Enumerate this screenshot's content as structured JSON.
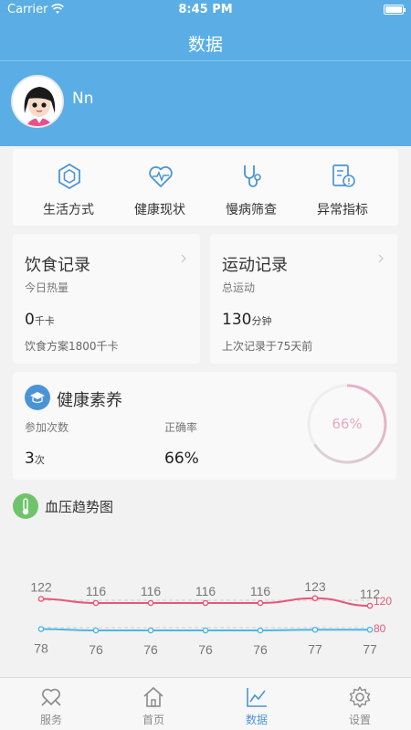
{
  "status_bar": {
    "carrier": "Carrier",
    "time": "8:45 PM"
  },
  "nav": {
    "title": "数据"
  },
  "user": {
    "name": "Nn"
  },
  "menu": [
    {
      "label": "生活方式",
      "icon": "hexagon-icon"
    },
    {
      "label": "健康现状",
      "icon": "heart-pulse-icon"
    },
    {
      "label": "慢病筛查",
      "icon": "stethoscope-icon"
    },
    {
      "label": "异常指标",
      "icon": "alert-report-icon"
    }
  ],
  "diet": {
    "title": "饮食记录",
    "subtitle": "今日热量",
    "value": "0",
    "unit": "千卡",
    "footer": "饮食方案1800千卡"
  },
  "exercise": {
    "title": "运动记录",
    "subtitle": "总运动",
    "value": "130",
    "unit": "分钟",
    "footer": "上次记录于75天前"
  },
  "health_literacy": {
    "title": "健康素养",
    "participation_label": "参加次数",
    "participation_value": "3",
    "participation_unit": "次",
    "accuracy_label": "正确率",
    "accuracy_value": "66%",
    "ring_text": "66%",
    "ring_fraction": 0.66
  },
  "bp": {
    "title": "血压趋势图"
  },
  "chart_data": {
    "type": "line",
    "title": "血压趋势图",
    "x": [
      1,
      2,
      3,
      4,
      5,
      6,
      7
    ],
    "series": [
      {
        "values": [
          122,
          116,
          116,
          116,
          116,
          123,
          112
        ],
        "color": "#e8557a"
      },
      {
        "values": [
          78,
          76,
          76,
          76,
          76,
          77,
          77
        ],
        "color": "#4fb5e3"
      }
    ],
    "reference_lines": [
      {
        "value": 120,
        "label": "120",
        "color": "#e8557a"
      },
      {
        "value": 80,
        "label": "80",
        "color": "#e8557a"
      }
    ]
  },
  "tabs": [
    {
      "label": "服务",
      "icon": "service-icon",
      "active": false
    },
    {
      "label": "首页",
      "icon": "home-icon",
      "active": false
    },
    {
      "label": "数据",
      "icon": "chart-icon",
      "active": true
    },
    {
      "label": "设置",
      "icon": "settings-icon",
      "active": false
    }
  ],
  "colors": {
    "header": "#5aaee5",
    "accent": "#4a94d6",
    "systolic": "#e8557a",
    "diastolic": "#4fb5e3"
  }
}
